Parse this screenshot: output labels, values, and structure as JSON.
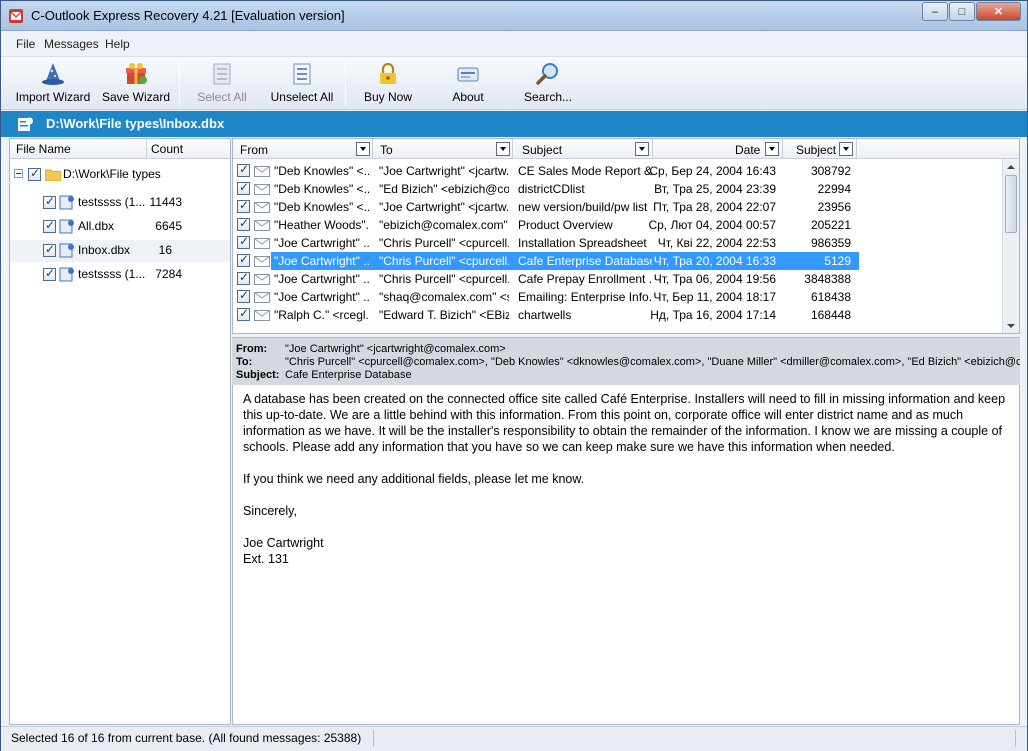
{
  "window": {
    "title": "C-Outlook Express Recovery 4.21 [Evaluation version]",
    "minimize_label": "–",
    "maximize_label": "□",
    "close_label": "✕"
  },
  "menu": {
    "items": [
      "File",
      "Messages",
      "Help"
    ]
  },
  "toolbar": {
    "import_wizard": "Import Wizard",
    "save_wizard": "Save Wizard",
    "select_all": "Select All",
    "unselect_all": "Unselect All",
    "buy_now": "Buy Now",
    "about": "About",
    "search": "Search..."
  },
  "path": "D:\\Work\\File types\\Inbox.dbx",
  "tree": {
    "header_name": "File Name",
    "header_count": "Count",
    "root": "D:\\Work\\File types",
    "items": [
      {
        "name": "testssss (1...",
        "count": "11443"
      },
      {
        "name": "All.dbx",
        "count": "6645"
      },
      {
        "name": "Inbox.dbx",
        "count": "16"
      },
      {
        "name": "testssss (1...",
        "count": "7284"
      }
    ]
  },
  "list": {
    "columns": {
      "from": "From",
      "to": "To",
      "subject": "Subject",
      "date": "Date",
      "size": "Subject"
    },
    "rows": [
      {
        "from": "\"Deb Knowles\" <...",
        "to": "\"Joe Cartwright\" <jcartw...",
        "subject": "CE Sales Mode Report & ...",
        "date": "Ср, Бер 24, 2004 16:43",
        "size": "308792"
      },
      {
        "from": "\"Deb Knowles\" <...",
        "to": "\"Ed Bizich\" <ebizich@co...",
        "subject": "districtCDlist",
        "date": "Вт, Тра 25, 2004 23:39",
        "size": "22994"
      },
      {
        "from": "\"Deb Knowles\" <...",
        "to": "\"Joe Cartwright\" <jcartw...",
        "subject": "new version/build/pw list",
        "date": "Пт, Тра 28, 2004 22:07",
        "size": "23956"
      },
      {
        "from": "\"Heather Woods\"...",
        "to": "\"ebizich@comalex.com\" ...",
        "subject": "Product Overview",
        "date": "Ср, Лют 04, 2004 00:57",
        "size": "205221"
      },
      {
        "from": "\"Joe Cartwright\" ...",
        "to": "\"Chris Purcell\" <cpurcell...",
        "subject": "Installation Spreadsheet",
        "date": "Чт, Кві 22, 2004 22:53",
        "size": "986359"
      },
      {
        "from": "\"Joe Cartwright\" ...",
        "to": "\"Chris Purcell\" <cpurcell...",
        "subject": "Cafe Enterprise Database",
        "date": "Чт, Тра 20, 2004 16:33",
        "size": "5129"
      },
      {
        "from": "\"Joe Cartwright\" ...",
        "to": "\"Chris Purcell\" <cpurcell...",
        "subject": "Cafe Prepay Enrollment ...",
        "date": "Чт, Тра 06, 2004 19:56",
        "size": "3848388"
      },
      {
        "from": "\"Joe Cartwright\" ...",
        "to": "\"shaq@comalex.com\" <s...",
        "subject": "Emailing: Enterprise Info...",
        "date": "Чт, Бер 11, 2004 18:17",
        "size": "618438"
      },
      {
        "from": "\"Ralph C.\" <rcegl...",
        "to": "\"Edward T. Bizich\" <EBizi...",
        "subject": "chartwells",
        "date": "Нд, Тра 16, 2004 17:14",
        "size": "168448"
      }
    ]
  },
  "header": {
    "from_label": "From:",
    "from": "\"Joe Cartwright\" <jcartwright@comalex.com>",
    "to_label": "To:",
    "to": "\"Chris Purcell\" <cpurcell@comalex.com>, \"Deb Knowles\" <dknowles@comalex.com>, \"Duane Miller\" <dmiller@comalex.com>, \"Ed Bizich\" <ebizich@coma",
    "subject_label": "Subject:",
    "subject": "Cafe Enterprise Database"
  },
  "body": {
    "paragraphs": [
      "A database has been created on the connected office site called Café Enterprise.  Installers will need to fill in missing information and keep this up-to-date.  We are a little behind with this information.   From this point on, corporate office will enter district name and as much information as we have.  It will be the installer's responsibility to obtain the remainder of the information.   I know we are missing a couple of schools.  Please add any information that you have so we can keep make sure we have this information when needed.",
      "If you think we need any additional fields, please let me know.",
      "Sincerely,"
    ],
    "signature_name": "Joe Cartwright",
    "signature_ext": "Ext. 131"
  },
  "status": {
    "text": "Selected 16 of 16 from current base. (All found messages: 25388)"
  },
  "icons": {
    "app": "app-icon",
    "import": "wizard-hat-icon",
    "save": "gift-box-icon",
    "select_all": "select-list-icon",
    "unselect_all": "list-icon",
    "buy": "lock-icon",
    "about": "card-icon",
    "search": "magnifier-icon"
  },
  "colors": {
    "pathbar": "#1f86c7",
    "selection": "#3399ff"
  }
}
